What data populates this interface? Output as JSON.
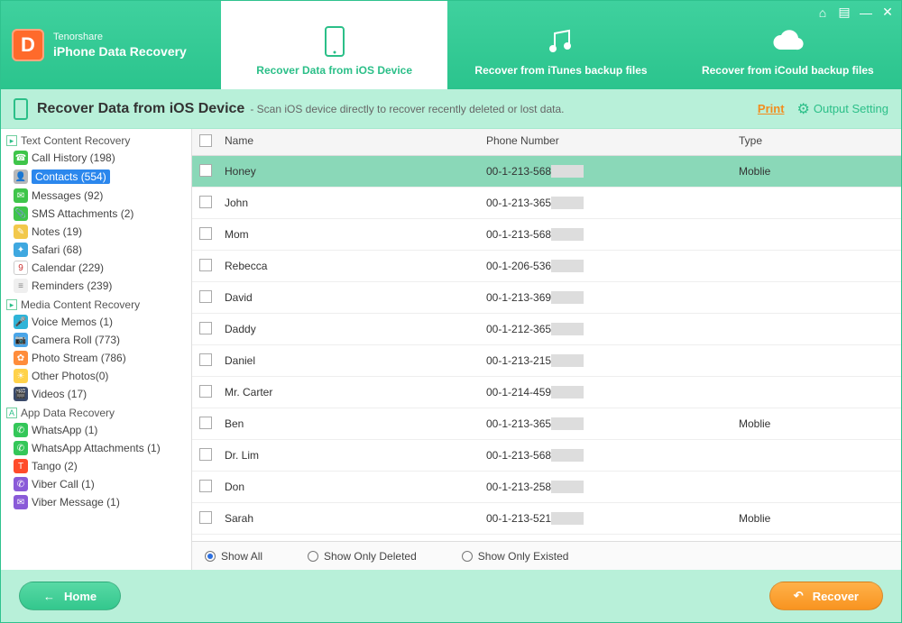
{
  "app": {
    "brand": "Tenorshare",
    "product": "iPhone Data Recovery"
  },
  "tabs": [
    {
      "label": "Recover Data from iOS Device",
      "active": true,
      "icon": "phone"
    },
    {
      "label": "Recover from iTunes backup files",
      "active": false,
      "icon": "music"
    },
    {
      "label": "Recover from iCould backup files",
      "active": false,
      "icon": "cloud"
    }
  ],
  "subheader": {
    "title": "Recover Data from iOS Device",
    "desc": "- Scan iOS device directly to recover recently deleted or lost data.",
    "print": "Print",
    "output_setting": "Output Setting"
  },
  "sidebar": {
    "groups": [
      {
        "title": "Text Content Recovery",
        "items": [
          {
            "label": "Call History (198)",
            "icon_bg": "#3fc54a",
            "glyph": "☎"
          },
          {
            "label": "Contacts (554)",
            "icon_bg": "#b8b8b8",
            "glyph": "👤",
            "selected": true
          },
          {
            "label": "Messages (92)",
            "icon_bg": "#3fc54a",
            "glyph": "✉"
          },
          {
            "label": "SMS Attachments (2)",
            "icon_bg": "#3fc54a",
            "glyph": "📎"
          },
          {
            "label": "Notes (19)",
            "icon_bg": "#f2c84b",
            "glyph": "✎"
          },
          {
            "label": "Safari (68)",
            "icon_bg": "#3fa8e0",
            "glyph": "✦"
          },
          {
            "label": "Calendar (229)",
            "icon_bg": "#ffffff",
            "glyph": "9",
            "glyph_color": "#cc3333",
            "border": true
          },
          {
            "label": "Reminders (239)",
            "icon_bg": "#efefef",
            "glyph": "≡",
            "glyph_color": "#888"
          }
        ]
      },
      {
        "title": "Media Content Recovery",
        "items": [
          {
            "label": "Voice Memos (1)",
            "icon_bg": "#2fb4d8",
            "glyph": "🎤"
          },
          {
            "label": "Camera Roll (773)",
            "icon_bg": "#4aa5e8",
            "glyph": "📷"
          },
          {
            "label": "Photo Stream (786)",
            "icon_bg": "#ff8c3b",
            "glyph": "✿"
          },
          {
            "label": "Other Photos(0)",
            "icon_bg": "#ffd24a",
            "glyph": "☀"
          },
          {
            "label": "Videos (17)",
            "icon_bg": "#3a4a6a",
            "glyph": "🎬"
          }
        ]
      },
      {
        "title": "App Data Recovery",
        "items": [
          {
            "label": "WhatsApp (1)",
            "icon_bg": "#34c759",
            "glyph": "✆"
          },
          {
            "label": "WhatsApp Attachments (1)",
            "icon_bg": "#34c759",
            "glyph": "✆"
          },
          {
            "label": "Tango (2)",
            "icon_bg": "#ff4b2b",
            "glyph": "T"
          },
          {
            "label": "Viber Call (1)",
            "icon_bg": "#8a5bd8",
            "glyph": "✆"
          },
          {
            "label": "Viber Message (1)",
            "icon_bg": "#8a5bd8",
            "glyph": "✉"
          }
        ]
      }
    ]
  },
  "table": {
    "headers": {
      "name": "Name",
      "phone": "Phone Number",
      "type": "Type"
    },
    "rows": [
      {
        "name": "Honey",
        "phone": "00-1-213-568",
        "type": "Moblie",
        "selected": true
      },
      {
        "name": "John",
        "phone": "00-1-213-365",
        "type": ""
      },
      {
        "name": "Mom",
        "phone": "00-1-213-568",
        "type": ""
      },
      {
        "name": "Rebecca",
        "phone": "00-1-206-536",
        "type": ""
      },
      {
        "name": "David",
        "phone": "00-1-213-369",
        "type": ""
      },
      {
        "name": "Daddy",
        "phone": "00-1-212-365",
        "type": ""
      },
      {
        "name": "Daniel",
        "phone": "00-1-213-215",
        "type": ""
      },
      {
        "name": "Mr. Carter",
        "phone": "00-1-214-459",
        "type": ""
      },
      {
        "name": "Ben",
        "phone": "00-1-213-365",
        "type": "Moblie"
      },
      {
        "name": "Dr. Lim",
        "phone": "00-1-213-568",
        "type": ""
      },
      {
        "name": "Don",
        "phone": "00-1-213-258",
        "type": ""
      },
      {
        "name": "Sarah",
        "phone": "00-1-213-521",
        "type": "Moblie"
      }
    ]
  },
  "filters": {
    "options": [
      {
        "label": "Show All",
        "selected": true
      },
      {
        "label": "Show Only Deleted",
        "selected": false
      },
      {
        "label": "Show Only Existed",
        "selected": false
      }
    ]
  },
  "footer": {
    "home": "Home",
    "recover": "Recover"
  }
}
